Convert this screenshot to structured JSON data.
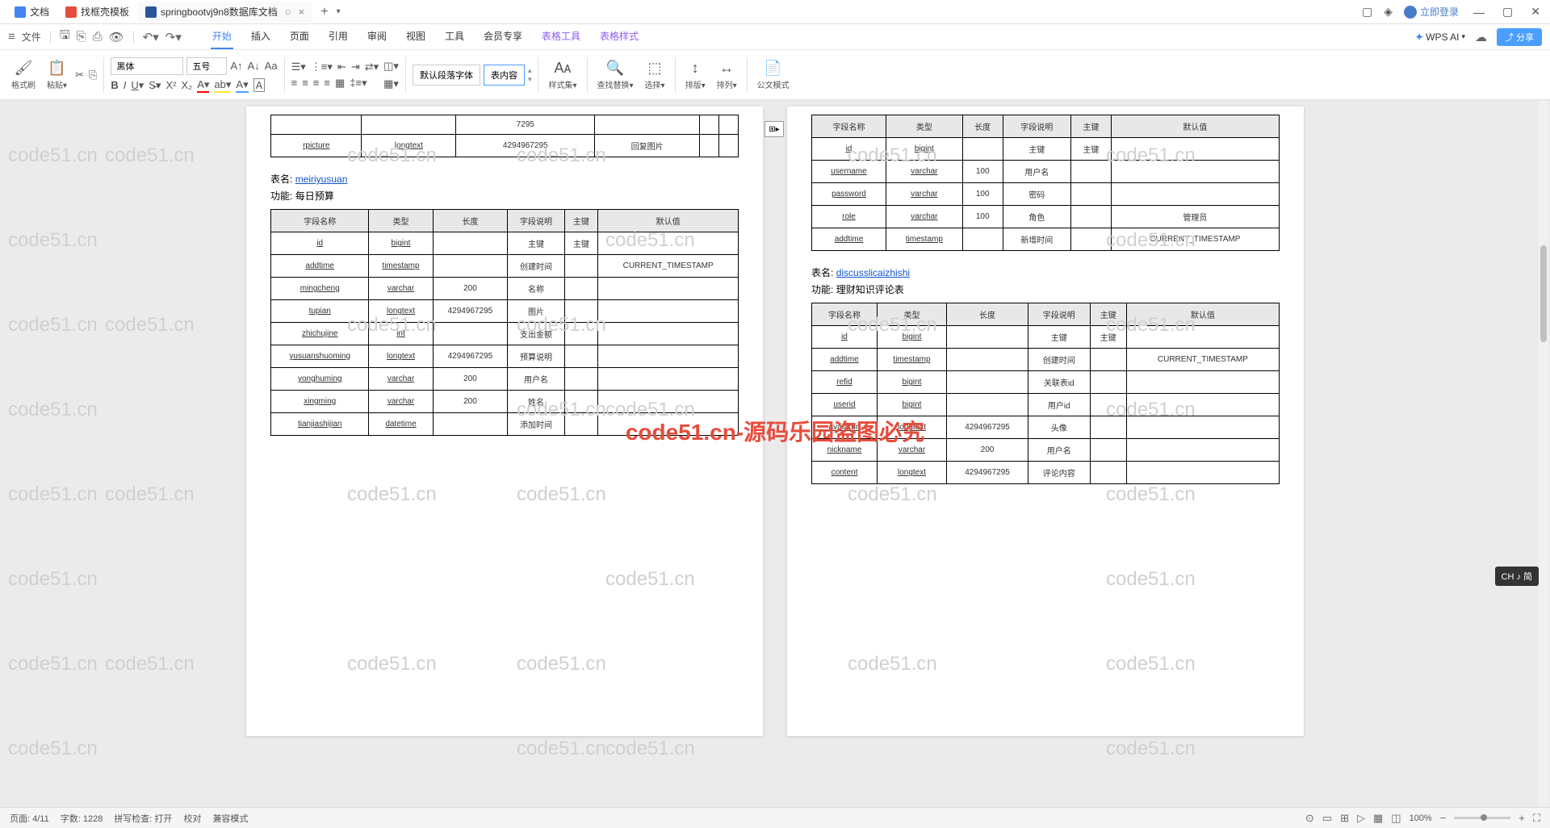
{
  "tabs": [
    {
      "icon": "doc",
      "label": "文档"
    },
    {
      "icon": "red",
      "label": "找框壳模板"
    },
    {
      "icon": "word",
      "label": "springbootvj9n8数据库文档",
      "active": true
    }
  ],
  "titlebar_right": {
    "login": "立即登录"
  },
  "menubar": {
    "file": "文件",
    "tabs": [
      "开始",
      "插入",
      "页面",
      "引用",
      "审阅",
      "视图",
      "工具",
      "会员专享"
    ],
    "table_tabs": [
      "表格工具",
      "表格样式"
    ],
    "wps_ai": "WPS AI",
    "share": "分享"
  },
  "ribbon": {
    "format_brush": "格式刷",
    "paste": "粘贴",
    "font_name": "黑体",
    "font_size": "五号",
    "para_default": "默认段落字体",
    "table_content": "表内容",
    "styles": "样式集",
    "find_replace": "查找替换",
    "select": "选择",
    "sort_v": "排版",
    "sort_h": "排列",
    "doc_mode": "公文模式"
  },
  "watermark_text": "code51.cn",
  "watermark_red": "code51.cn-源码乐园盗图必究",
  "page_left": {
    "top_rows": [
      {
        "c": [
          "",
          "",
          "7295",
          "",
          "",
          ""
        ]
      },
      {
        "c": [
          "rpicture",
          "longtext",
          "4294967295",
          "回复图片",
          "",
          ""
        ]
      }
    ],
    "table_label": "表名:",
    "table_name": "meiriyusuan",
    "func_label": "功能:",
    "func_name": "每日预算",
    "headers": [
      "字段名称",
      "类型",
      "长度",
      "字段说明",
      "主键",
      "默认值"
    ],
    "rows": [
      {
        "c": [
          "id",
          "bigint",
          "",
          "主键",
          "主键",
          ""
        ]
      },
      {
        "c": [
          "addtime",
          "timestamp",
          "",
          "创建时间",
          "",
          "CURRENT_TIMESTAMP"
        ]
      },
      {
        "c": [
          "mingcheng",
          "varchar",
          "200",
          "名称",
          "",
          ""
        ]
      },
      {
        "c": [
          "tupian",
          "longtext",
          "4294967295",
          "图片",
          "",
          ""
        ]
      },
      {
        "c": [
          "zhichujine",
          "int",
          "",
          "支出金额",
          "",
          ""
        ]
      },
      {
        "c": [
          "yusuanshuoming",
          "longtext",
          "4294967295",
          "预算说明",
          "",
          ""
        ]
      },
      {
        "c": [
          "yonghuming",
          "varchar",
          "200",
          "用户名",
          "",
          ""
        ]
      },
      {
        "c": [
          "xingming",
          "varchar",
          "200",
          "姓名",
          "",
          ""
        ]
      },
      {
        "c": [
          "tianjiashijian",
          "datetime",
          "",
          "添加时间",
          "",
          ""
        ]
      }
    ]
  },
  "page_right": {
    "headers": [
      "字段名称",
      "类型",
      "长度",
      "字段说明",
      "主键",
      "默认值"
    ],
    "top_rows": [
      {
        "c": [
          "id",
          "bigint",
          "",
          "主键",
          "主键",
          ""
        ]
      },
      {
        "c": [
          "username",
          "varchar",
          "100",
          "用户名",
          "",
          ""
        ]
      },
      {
        "c": [
          "password",
          "varchar",
          "100",
          "密码",
          "",
          ""
        ]
      },
      {
        "c": [
          "role",
          "varchar",
          "100",
          "角色",
          "",
          "管理员"
        ]
      },
      {
        "c": [
          "addtime",
          "timestamp",
          "",
          "新增时间",
          "",
          "CURRENT_TIMESTAMP"
        ]
      }
    ],
    "table_label": "表名:",
    "table_name": "discusslicaizhishi",
    "func_label": "功能:",
    "func_name": "理财知识评论表",
    "rows": [
      {
        "c": [
          "id",
          "bigint",
          "",
          "主键",
          "主键",
          ""
        ]
      },
      {
        "c": [
          "addtime",
          "timestamp",
          "",
          "创建时间",
          "",
          "CURRENT_TIMESTAMP"
        ]
      },
      {
        "c": [
          "refid",
          "bigint",
          "",
          "关联表id",
          "",
          ""
        ]
      },
      {
        "c": [
          "userid",
          "bigint",
          "",
          "用户id",
          "",
          ""
        ]
      },
      {
        "c": [
          "avatarurl",
          "longtext",
          "4294967295",
          "头像",
          "",
          ""
        ]
      },
      {
        "c": [
          "nickname",
          "varchar",
          "200",
          "用户名",
          "",
          ""
        ]
      },
      {
        "c": [
          "content",
          "longtext",
          "4294967295",
          "评论内容",
          "",
          ""
        ]
      }
    ]
  },
  "statusbar": {
    "page": "页面: 4/11",
    "words": "字数: 1228",
    "spell": "拼写检查: 打开",
    "proof": "校对",
    "compat": "兼容模式",
    "zoom": "100%"
  },
  "ime": "CH ♪ 简"
}
